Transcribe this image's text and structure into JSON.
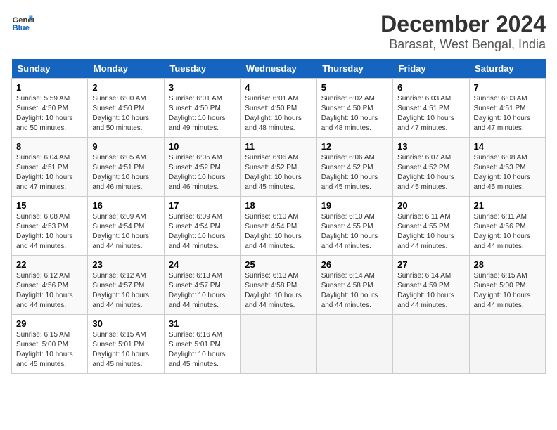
{
  "logo": {
    "line1": "General",
    "line2": "Blue"
  },
  "title": "December 2024",
  "subtitle": "Barasat, West Bengal, India",
  "weekdays": [
    "Sunday",
    "Monday",
    "Tuesday",
    "Wednesday",
    "Thursday",
    "Friday",
    "Saturday"
  ],
  "weeks": [
    [
      {
        "day": "1",
        "sunrise": "5:59 AM",
        "sunset": "4:50 PM",
        "daylight": "10 hours and 50 minutes."
      },
      {
        "day": "2",
        "sunrise": "6:00 AM",
        "sunset": "4:50 PM",
        "daylight": "10 hours and 50 minutes."
      },
      {
        "day": "3",
        "sunrise": "6:01 AM",
        "sunset": "4:50 PM",
        "daylight": "10 hours and 49 minutes."
      },
      {
        "day": "4",
        "sunrise": "6:01 AM",
        "sunset": "4:50 PM",
        "daylight": "10 hours and 48 minutes."
      },
      {
        "day": "5",
        "sunrise": "6:02 AM",
        "sunset": "4:50 PM",
        "daylight": "10 hours and 48 minutes."
      },
      {
        "day": "6",
        "sunrise": "6:03 AM",
        "sunset": "4:51 PM",
        "daylight": "10 hours and 47 minutes."
      },
      {
        "day": "7",
        "sunrise": "6:03 AM",
        "sunset": "4:51 PM",
        "daylight": "10 hours and 47 minutes."
      }
    ],
    [
      {
        "day": "8",
        "sunrise": "6:04 AM",
        "sunset": "4:51 PM",
        "daylight": "10 hours and 47 minutes."
      },
      {
        "day": "9",
        "sunrise": "6:05 AM",
        "sunset": "4:51 PM",
        "daylight": "10 hours and 46 minutes."
      },
      {
        "day": "10",
        "sunrise": "6:05 AM",
        "sunset": "4:52 PM",
        "daylight": "10 hours and 46 minutes."
      },
      {
        "day": "11",
        "sunrise": "6:06 AM",
        "sunset": "4:52 PM",
        "daylight": "10 hours and 45 minutes."
      },
      {
        "day": "12",
        "sunrise": "6:06 AM",
        "sunset": "4:52 PM",
        "daylight": "10 hours and 45 minutes."
      },
      {
        "day": "13",
        "sunrise": "6:07 AM",
        "sunset": "4:52 PM",
        "daylight": "10 hours and 45 minutes."
      },
      {
        "day": "14",
        "sunrise": "6:08 AM",
        "sunset": "4:53 PM",
        "daylight": "10 hours and 45 minutes."
      }
    ],
    [
      {
        "day": "15",
        "sunrise": "6:08 AM",
        "sunset": "4:53 PM",
        "daylight": "10 hours and 44 minutes."
      },
      {
        "day": "16",
        "sunrise": "6:09 AM",
        "sunset": "4:54 PM",
        "daylight": "10 hours and 44 minutes."
      },
      {
        "day": "17",
        "sunrise": "6:09 AM",
        "sunset": "4:54 PM",
        "daylight": "10 hours and 44 minutes."
      },
      {
        "day": "18",
        "sunrise": "6:10 AM",
        "sunset": "4:54 PM",
        "daylight": "10 hours and 44 minutes."
      },
      {
        "day": "19",
        "sunrise": "6:10 AM",
        "sunset": "4:55 PM",
        "daylight": "10 hours and 44 minutes."
      },
      {
        "day": "20",
        "sunrise": "6:11 AM",
        "sunset": "4:55 PM",
        "daylight": "10 hours and 44 minutes."
      },
      {
        "day": "21",
        "sunrise": "6:11 AM",
        "sunset": "4:56 PM",
        "daylight": "10 hours and 44 minutes."
      }
    ],
    [
      {
        "day": "22",
        "sunrise": "6:12 AM",
        "sunset": "4:56 PM",
        "daylight": "10 hours and 44 minutes."
      },
      {
        "day": "23",
        "sunrise": "6:12 AM",
        "sunset": "4:57 PM",
        "daylight": "10 hours and 44 minutes."
      },
      {
        "day": "24",
        "sunrise": "6:13 AM",
        "sunset": "4:57 PM",
        "daylight": "10 hours and 44 minutes."
      },
      {
        "day": "25",
        "sunrise": "6:13 AM",
        "sunset": "4:58 PM",
        "daylight": "10 hours and 44 minutes."
      },
      {
        "day": "26",
        "sunrise": "6:14 AM",
        "sunset": "4:58 PM",
        "daylight": "10 hours and 44 minutes."
      },
      {
        "day": "27",
        "sunrise": "6:14 AM",
        "sunset": "4:59 PM",
        "daylight": "10 hours and 44 minutes."
      },
      {
        "day": "28",
        "sunrise": "6:15 AM",
        "sunset": "5:00 PM",
        "daylight": "10 hours and 44 minutes."
      }
    ],
    [
      {
        "day": "29",
        "sunrise": "6:15 AM",
        "sunset": "5:00 PM",
        "daylight": "10 hours and 45 minutes."
      },
      {
        "day": "30",
        "sunrise": "6:15 AM",
        "sunset": "5:01 PM",
        "daylight": "10 hours and 45 minutes."
      },
      {
        "day": "31",
        "sunrise": "6:16 AM",
        "sunset": "5:01 PM",
        "daylight": "10 hours and 45 minutes."
      },
      null,
      null,
      null,
      null
    ]
  ]
}
